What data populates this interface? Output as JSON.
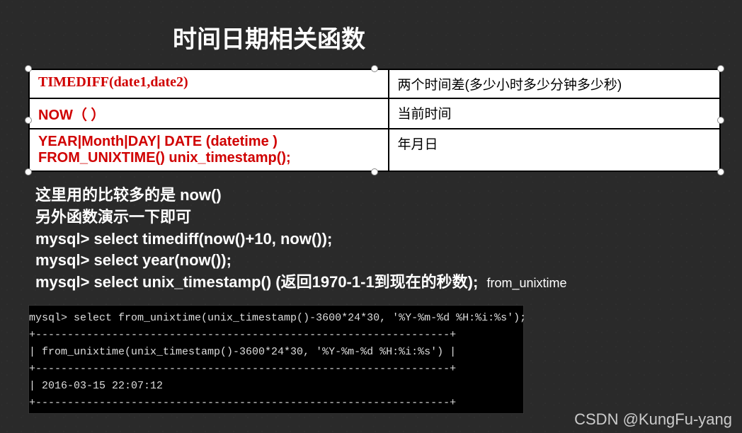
{
  "title": "时间日期相关函数",
  "table": {
    "rows": [
      {
        "fn": "TIMEDIFF(date1,date2)",
        "desc": "两个时间差(多少小时多少分钟多少秒)"
      },
      {
        "fn": "NOW（ ）",
        "desc": "当前时间"
      },
      {
        "fn": "YEAR|Month|DAY| DATE (datetime )\nFROM_UNIXTIME()  unix_timestamp();",
        "desc": "年月日"
      }
    ]
  },
  "notes": {
    "l1": "这里用的比较多的是 now()",
    "l2": "另外函数演示一下即可",
    "l3": "mysql> select timediff(now()+10, now());",
    "l4": "mysql> select year(now());",
    "l5": "mysql> select unix_timestamp() (返回1970-1-1到现在的秒数);",
    "l5_trail": "from_unixtime"
  },
  "terminal": {
    "t1": "mysql> select from_unixtime(unix_timestamp()-3600*24*30, '%Y-%m-%d %H:%i:%s');",
    "d1": "+-----------------------------------------------------------------+",
    "t2": "| from_unixtime(unix_timestamp()-3600*24*30, '%Y-%m-%d %H:%i:%s') |",
    "d2": "+-----------------------------------------------------------------+",
    "t3": "| 2016-03-15 22:07:12",
    "d3": "+-----------------------------------------------------------------+"
  },
  "watermark": "CSDN @KungFu-yang"
}
